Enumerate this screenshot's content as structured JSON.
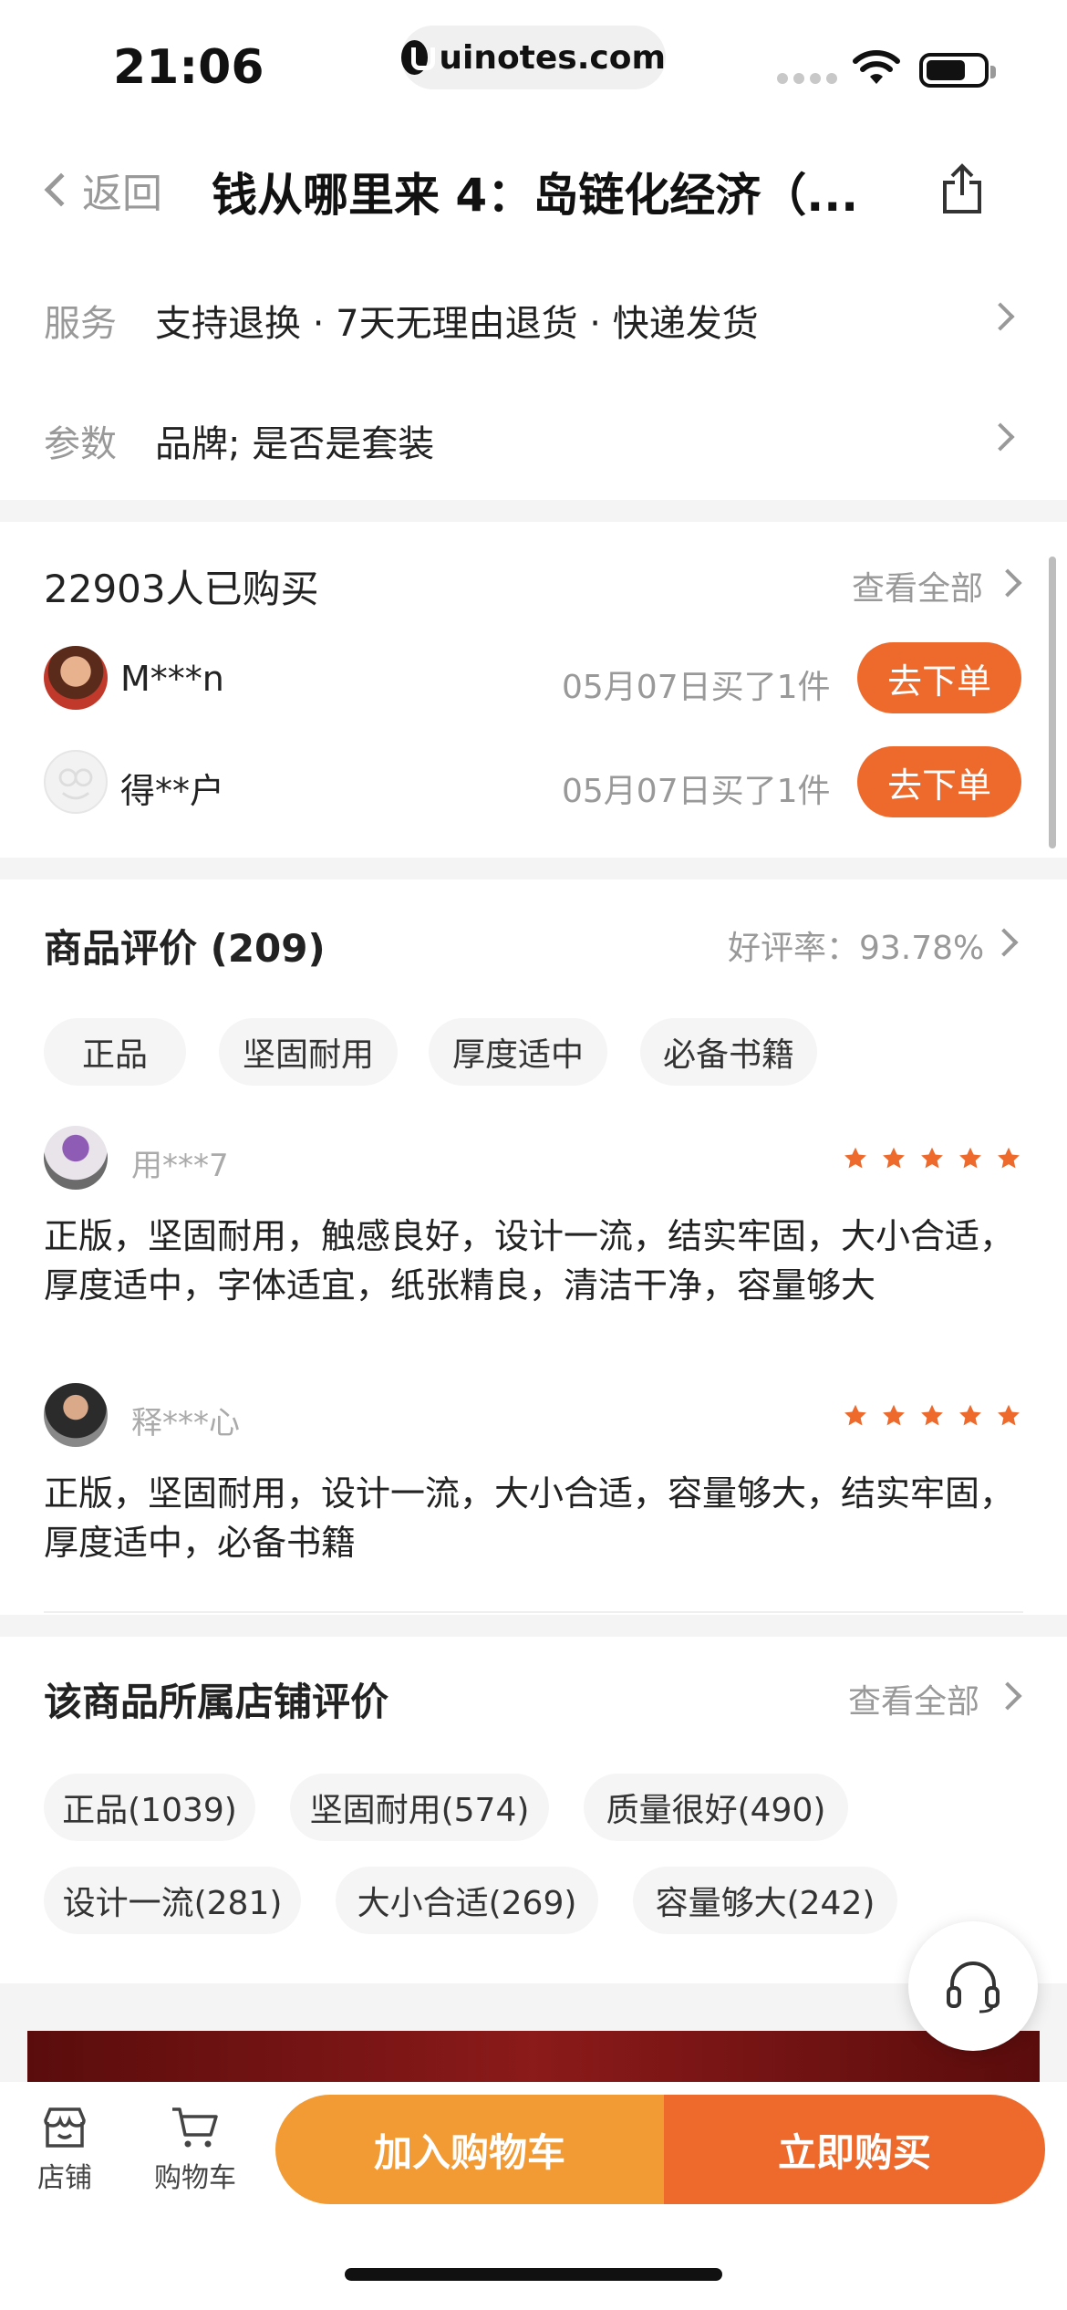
{
  "status_bar": {
    "time": "21:06",
    "url": "uinotes.com"
  },
  "nav": {
    "back_label": "返回",
    "title": "钱从哪里来 4：岛链化经济（..."
  },
  "service": {
    "label": "服务",
    "value": "支持退换 · 7天无理由退货 · 快递发货"
  },
  "params": {
    "label": "参数",
    "value": "品牌; 是否是套装"
  },
  "buyers": {
    "title": "22903人已购买",
    "view_all": "查看全部",
    "items": [
      {
        "name": "M***n",
        "date": "05月07日买了1件",
        "button": "去下单"
      },
      {
        "name": "得**户",
        "date": "05月07日买了1件",
        "button": "去下单"
      }
    ]
  },
  "reviews": {
    "title": "商品评价 (209)",
    "rate": "好评率：93.78%",
    "tags": [
      "正品",
      "坚固耐用",
      "厚度适中",
      "必备书籍"
    ],
    "items": [
      {
        "name": "用***7",
        "stars": 5,
        "text": "正版，坚固耐用，触感良好，设计一流，结实牢固，大小合适，厚度适中，字体适宜，纸张精良，清洁干净，容量够大"
      },
      {
        "name": "释***心",
        "stars": 5,
        "text": "正版，坚固耐用，设计一流，大小合适，容量够大，结实牢固，厚度适中，必备书籍"
      }
    ]
  },
  "store_reviews": {
    "title": "该商品所属店铺评价",
    "view_all": "查看全部",
    "tags": [
      "正品(1039)",
      "坚固耐用(574)",
      "质量很好(490)",
      "设计一流(281)",
      "大小合适(269)",
      "容量够大(242)"
    ]
  },
  "bottom_bar": {
    "store_label": "店铺",
    "cart_label": "购物车",
    "add_to_cart": "加入购物车",
    "buy_now": "立即购买"
  },
  "colors": {
    "accent_orange": "#ee6a2c",
    "cart_orange": "#f29a33",
    "star": "#ee6a2c"
  },
  "icons": [
    "lock-icon",
    "wifi-icon",
    "battery-icon",
    "back-chevron-icon",
    "share-icon",
    "chevron-right-icon",
    "star-icon",
    "headset-icon",
    "store-icon",
    "cart-icon"
  ]
}
